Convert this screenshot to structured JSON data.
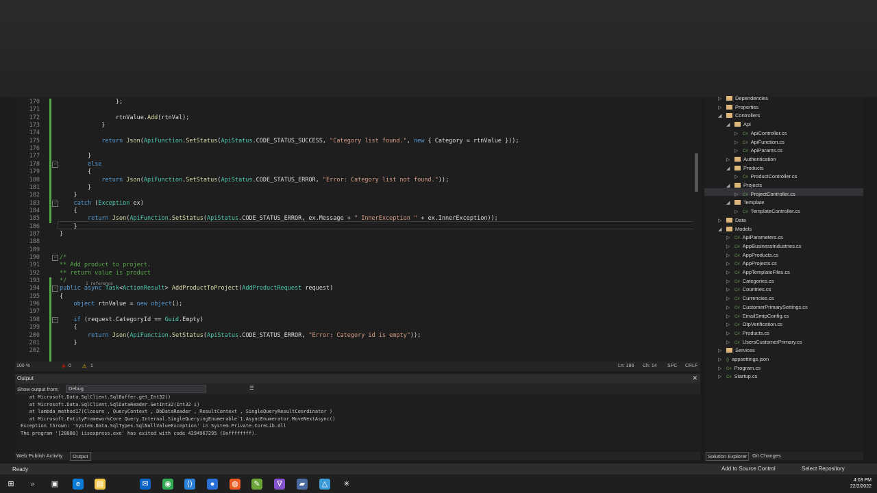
{
  "editor": {
    "lines": [
      {
        "n": "170",
        "code": "                };"
      },
      {
        "n": "171",
        "code": ""
      },
      {
        "n": "172",
        "code": "                rtnValue.Add(rtnVal);"
      },
      {
        "n": "173",
        "code": "            }"
      },
      {
        "n": "174",
        "code": ""
      },
      {
        "n": "175",
        "code": "            return Json(ApiFunction.SetStatus(ApiStatus.CODE_STATUS_SUCCESS, \"Category list found.\", new { Category = rtnValue }));"
      },
      {
        "n": "176",
        "code": ""
      },
      {
        "n": "177",
        "code": "        }"
      },
      {
        "n": "178",
        "code": "        else"
      },
      {
        "n": "179",
        "code": "        {"
      },
      {
        "n": "180",
        "code": "            return Json(ApiFunction.SetStatus(ApiStatus.CODE_STATUS_ERROR, \"Error: Category list not found.\"));"
      },
      {
        "n": "181",
        "code": "        }"
      },
      {
        "n": "182",
        "code": "    }"
      },
      {
        "n": "183",
        "code": "    catch (Exception ex)"
      },
      {
        "n": "184",
        "code": "    {"
      },
      {
        "n": "185",
        "code": "        return Json(ApiFunction.SetStatus(ApiStatus.CODE_STATUS_ERROR, ex.Message + \" InnerException \" + ex.InnerException));"
      },
      {
        "n": "186",
        "code": "    }"
      },
      {
        "n": "187",
        "code": "}"
      },
      {
        "n": "188",
        "code": ""
      },
      {
        "n": "189",
        "code": ""
      },
      {
        "n": "190",
        "code": "/*"
      },
      {
        "n": "191",
        "code": "** Add product to project."
      },
      {
        "n": "192",
        "code": "** return value is product"
      },
      {
        "n": "193",
        "code": "*/"
      },
      {
        "n": "194",
        "code": "public async Task<ActionResult> AddProductToProject(AddProductRequest request)"
      },
      {
        "n": "195",
        "code": "{"
      },
      {
        "n": "196",
        "code": "    object rtnValue = new object();"
      },
      {
        "n": "197",
        "code": ""
      },
      {
        "n": "198",
        "code": "    if (request.CategoryId == Guid.Empty)"
      },
      {
        "n": "199",
        "code": "    {"
      },
      {
        "n": "200",
        "code": "        return Json(ApiFunction.SetStatus(ApiStatus.CODE_STATUS_ERROR, \"Error: Category id is empty\"));"
      },
      {
        "n": "201",
        "code": "    }"
      },
      {
        "n": "202",
        "code": ""
      }
    ],
    "codelens": "1 reference"
  },
  "status": {
    "zoom": "100 %",
    "errors": "0",
    "warnings": "1",
    "line": "Ln: 186",
    "col": "Ch: 14",
    "spc": "SPC",
    "crlf": "CRLF"
  },
  "output": {
    "title": "Output",
    "show_from_label": "Show output from:",
    "source": "Debug",
    "lines": [
      "   at Microsoft.Data.SqlClient.SqlBuffer.get_Int32()",
      "   at Microsoft.Data.SqlClient.SqlDataReader.GetInt32(Int32 i)",
      "   at lambda_method17(Closure , QueryContext , DbDataReader , ResultContext , SingleQueryResultCoordinator )",
      "   at Microsoft.EntityFrameworkCore.Query.Internal.SingleQueryingEnumerable`1.AsyncEnumerator.MoveNextAsync()",
      "Exception thrown: 'System.Data.SqlTypes.SqlNullValueException' in System.Private.CoreLib.dll",
      "The program '[28888] iisexpress.exe' has exited with code 4294967295 (0xffffffff)."
    ],
    "tabs": [
      "Web Publish Activity",
      "Output"
    ]
  },
  "solution": {
    "items": [
      {
        "label": "Dependencies",
        "depth": 1,
        "kind": "folder",
        "arrow": "▷"
      },
      {
        "label": "Properties",
        "depth": 1,
        "kind": "folder",
        "arrow": "▷"
      },
      {
        "label": "Controllers",
        "depth": 1,
        "kind": "folder",
        "arrow": "◢"
      },
      {
        "label": "Api",
        "depth": 2,
        "kind": "folder",
        "arrow": "◢"
      },
      {
        "label": "ApiController.cs",
        "depth": 3,
        "kind": "cs",
        "arrow": "▷"
      },
      {
        "label": "ApiFunction.cs",
        "depth": 3,
        "kind": "cs",
        "arrow": "▷"
      },
      {
        "label": "ApiParams.cs",
        "depth": 3,
        "kind": "cs",
        "arrow": "▷"
      },
      {
        "label": "Authentication",
        "depth": 2,
        "kind": "folder",
        "arrow": "▷"
      },
      {
        "label": "Products",
        "depth": 2,
        "kind": "folder",
        "arrow": "◢"
      },
      {
        "label": "ProductController.cs",
        "depth": 3,
        "kind": "cs",
        "arrow": "▷"
      },
      {
        "label": "Projects",
        "depth": 2,
        "kind": "folder",
        "arrow": "◢"
      },
      {
        "label": "ProjectController.cs",
        "depth": 3,
        "kind": "cs",
        "arrow": "▷"
      },
      {
        "label": "Template",
        "depth": 2,
        "kind": "folder",
        "arrow": "◢"
      },
      {
        "label": "TemplateController.cs",
        "depth": 3,
        "kind": "cs",
        "arrow": "▷"
      },
      {
        "label": "Data",
        "depth": 1,
        "kind": "folder",
        "arrow": "▷"
      },
      {
        "label": "Models",
        "depth": 1,
        "kind": "folder",
        "arrow": "◢"
      },
      {
        "label": "ApiParameters.cs",
        "depth": 2,
        "kind": "cs",
        "arrow": "▷"
      },
      {
        "label": "AppBusinessIndustries.cs",
        "depth": 2,
        "kind": "cs",
        "arrow": "▷"
      },
      {
        "label": "AppProducts.cs",
        "depth": 2,
        "kind": "cs",
        "arrow": "▷"
      },
      {
        "label": "AppProjects.cs",
        "depth": 2,
        "kind": "cs",
        "arrow": "▷"
      },
      {
        "label": "AppTemplateFiles.cs",
        "depth": 2,
        "kind": "cs",
        "arrow": "▷"
      },
      {
        "label": "Categories.cs",
        "depth": 2,
        "kind": "cs",
        "arrow": "▷"
      },
      {
        "label": "Countries.cs",
        "depth": 2,
        "kind": "cs",
        "arrow": "▷"
      },
      {
        "label": "Currencies.cs",
        "depth": 2,
        "kind": "cs",
        "arrow": "▷"
      },
      {
        "label": "CustomerPrimarySettings.cs",
        "depth": 2,
        "kind": "cs",
        "arrow": "▷"
      },
      {
        "label": "EmailSmtpConfig.cs",
        "depth": 2,
        "kind": "cs",
        "arrow": "▷"
      },
      {
        "label": "OtpVerification.cs",
        "depth": 2,
        "kind": "cs",
        "arrow": "▷"
      },
      {
        "label": "Products.cs",
        "depth": 2,
        "kind": "cs",
        "arrow": "▷"
      },
      {
        "label": "UsersCustomerPrimary.cs",
        "depth": 2,
        "kind": "cs",
        "arrow": "▷"
      },
      {
        "label": "Services",
        "depth": 1,
        "kind": "folder",
        "arrow": "▷"
      },
      {
        "label": "appsettings.json",
        "depth": 1,
        "kind": "json",
        "arrow": "▷"
      },
      {
        "label": "Program.cs",
        "depth": 1,
        "kind": "cs",
        "arrow": "▷"
      },
      {
        "label": "Startup.cs",
        "depth": 1,
        "kind": "cs",
        "arrow": "▷"
      }
    ],
    "selected": "ProjectController.cs",
    "tabs": [
      "Solution Explorer",
      "Git Changes"
    ]
  },
  "statusline": {
    "ready": "Ready",
    "add_source": "Add to Source Control",
    "select_repo": "Select Repository"
  },
  "clock": {
    "time": "4:03 PM",
    "date": "22/2/2022"
  },
  "taskbar_icons": [
    "windows-start-icon",
    "search-icon",
    "task-view-icon",
    "edge-icon",
    "file-explorer-icon",
    "mail-icon",
    "chrome-icon",
    "vscode-icon",
    "signal-icon",
    "postman-icon",
    "notepad-icon",
    "visual-studio-icon",
    "azure-data-studio-icon",
    "azure-icon",
    "chatgpt-icon"
  ]
}
